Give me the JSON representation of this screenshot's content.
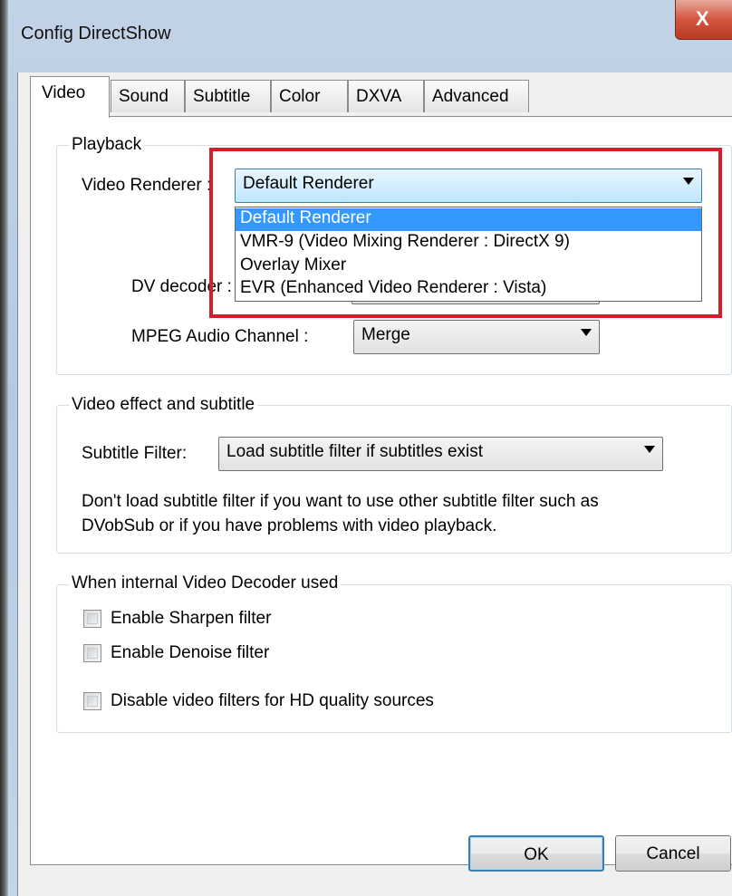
{
  "window": {
    "title": "Config DirectShow",
    "close_glyph": "X"
  },
  "tabs": [
    "Video",
    "Sound",
    "Subtitle",
    "Color",
    "DXVA",
    "Advanced"
  ],
  "playback": {
    "legend": "Playback",
    "video_renderer_label": "Video Renderer :",
    "video_renderer_value": "Default Renderer",
    "renderer_options": [
      "Default Renderer",
      "VMR-9 (Video Mixing Renderer : DirectX 9)",
      "Overlay Mixer",
      "EVR (Enhanced Video Renderer : Vista)"
    ],
    "dv_decoder_label": "DV decoder :",
    "mpeg_audio_label": "MPEG Audio Channel :",
    "mpeg_audio_value": "Merge"
  },
  "video_effect": {
    "legend": "Video effect and subtitle",
    "subtitle_filter_label": "Subtitle Filter:",
    "subtitle_filter_value": "Load subtitle filter if subtitles exist",
    "note_line1": "Don't load subtitle filter if you want to use other subtitle filter such as",
    "note_line2": "DVobSub or if you have problems with video playback."
  },
  "decoder": {
    "legend": "When internal Video Decoder used",
    "sharpen": "Enable Sharpen filter",
    "denoise": "Enable Denoise filter",
    "disable_hd": "Disable video filters for HD quality sources"
  },
  "buttons": {
    "ok": "OK",
    "cancel": "Cancel"
  },
  "colors": {
    "highlight": "#3399ff",
    "annotation_box": "#d2202a"
  }
}
